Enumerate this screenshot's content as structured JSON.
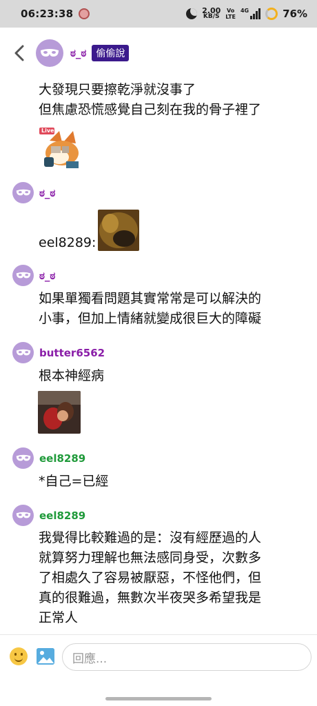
{
  "status_bar": {
    "time": "06:23:38",
    "net_speed": "2.00",
    "net_unit": "KB/S",
    "vo": "Vo",
    "lte": "LTE",
    "signal_label": "4G",
    "battery": "76%"
  },
  "header": {
    "username": "ಠ_ಠ",
    "badge": "偷偷說"
  },
  "posts": [
    {
      "lines": [
        "大發現只要擦乾淨就沒事了",
        "但焦慮恐慌感覺自己刻在我的骨子裡了"
      ],
      "sticker_label": "Live"
    },
    {
      "username": "ಠ_ಠ",
      "text": "eel8289:"
    },
    {
      "username": "ಠ_ಠ",
      "lines": [
        "如果單獨看問題其實常常是可以解決的",
        "小事，但加上情緒就變成很巨大的障礙"
      ]
    },
    {
      "username": "butter6562",
      "text": "根本神經病"
    },
    {
      "username": "eel8289",
      "text": "*自己=已經"
    },
    {
      "username": "eel8289",
      "lines": [
        "我覺得比較難過的是：沒有經歷過的人",
        "就算努力理解也無法感同身受，次數多",
        "了相處久了容易被厭惡，不怪他們，但",
        "真的很難過，無數次半夜哭多希望我是",
        "正常人"
      ]
    }
  ],
  "composer": {
    "placeholder": "回應..."
  },
  "colors": {
    "purple_name": "#8a1ea8",
    "green_name": "#1f9a3a",
    "badge_bg": "#3b1a8c",
    "avatar_bg": "#b79bd8"
  }
}
